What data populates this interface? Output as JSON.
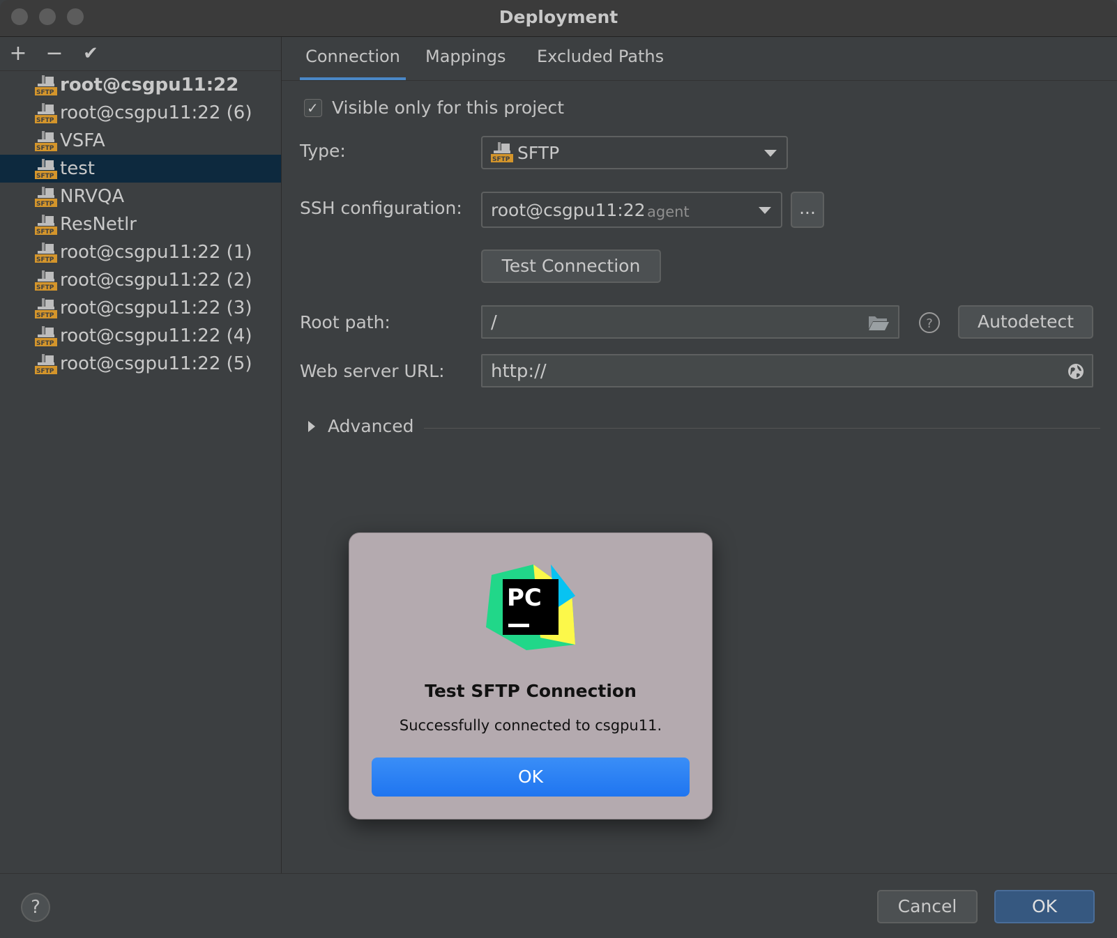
{
  "window": {
    "title": "Deployment"
  },
  "toolbar": {
    "add": "+",
    "remove": "−",
    "check": "✔"
  },
  "servers": [
    {
      "name": "root@csgpu11:22",
      "bold": true
    },
    {
      "name": "root@csgpu11:22 (6)"
    },
    {
      "name": "VSFA"
    },
    {
      "name": "test",
      "selected": true
    },
    {
      "name": "NRVQA"
    },
    {
      "name": "ResNetlr"
    },
    {
      "name": "root@csgpu11:22 (1)"
    },
    {
      "name": "root@csgpu11:22 (2)"
    },
    {
      "name": "root@csgpu11:22 (3)"
    },
    {
      "name": "root@csgpu11:22 (4)"
    },
    {
      "name": "root@csgpu11:22 (5)"
    }
  ],
  "tabs": [
    {
      "label": "Connection",
      "active": true
    },
    {
      "label": "Mappings"
    },
    {
      "label": "Excluded Paths"
    }
  ],
  "form": {
    "visible_only_label": "Visible only for this project",
    "visible_only_checked": true,
    "type_label": "Type:",
    "type_value": "SFTP",
    "ssh_label": "SSH configuration:",
    "ssh_value": "root@csgpu11:22",
    "ssh_suffix": "agent",
    "ssh_more": "...",
    "test_connection": "Test Connection",
    "root_path_label": "Root path:",
    "root_path_value": "/",
    "autodetect": "Autodetect",
    "web_url_label": "Web server URL:",
    "web_url_value": "http://",
    "advanced": "Advanced"
  },
  "footer": {
    "help": "?",
    "cancel": "Cancel",
    "ok": "OK"
  },
  "dialog": {
    "logo_text": "PC",
    "title": "Test SFTP Connection",
    "message": "Successfully connected to csgpu11.",
    "ok": "OK"
  },
  "colors": {
    "accent": "#4a88c7",
    "selection": "#0d293e",
    "dialog_button": "#1f75f0"
  }
}
